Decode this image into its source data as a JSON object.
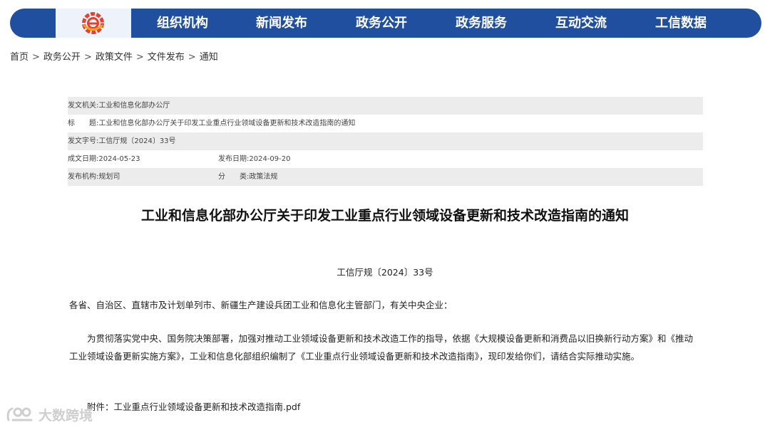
{
  "nav": {
    "logo_icon": "ministry-logo-icon",
    "items": [
      {
        "label": "组织机构"
      },
      {
        "label": "新闻发布"
      },
      {
        "label": "政务公开"
      },
      {
        "label": "政务服务"
      },
      {
        "label": "互动交流"
      },
      {
        "label": "工信数据"
      }
    ]
  },
  "breadcrumb": {
    "items": [
      "首页",
      "政务公开",
      "政策文件",
      "文件发布",
      "通知"
    ],
    "separator": ">"
  },
  "meta": {
    "issuer_label": "发文机关:",
    "issuer": "工业和信息化部办公厅",
    "title_label": "标　　题:",
    "title": "工业和信息化部办公厅关于印发工业重点行业领域设备更新和技术改造指南的通知",
    "doc_no_label": "发文字号:",
    "doc_no": "工信厅规〔2024〕33号",
    "created_label": "成文日期:",
    "created": "2024-05-23",
    "published_label": "发布日期:",
    "published": "2024-09-20",
    "org_label": "发布机构:",
    "org": "规划司",
    "category_label": "分　　类:",
    "category": "政策法规"
  },
  "document": {
    "title": "工业和信息化部办公厅关于印发工业重点行业领域设备更新和技术改造指南的通知",
    "number": "工信厅规〔2024〕33号",
    "addressee": "各省、自治区、直辖市及计划单列市、新疆生产建设兵团工业和信息化主管部门，有关中央企业：",
    "body": "为贯彻落实党中央、国务院决策部署，加强对推动工业领域设备更新和技术改造工作的指导，依据《大规模设备更新和消费品以旧换新行动方案》和《推动工业领域设备更新实施方案》，工业和信息化部组织编制了《工业重点行业领域设备更新和技术改造指南》，现印发给你们，请结合实际推动实施。",
    "attachment_label": "附件：",
    "attachment": "工业重点行业领域设备更新和技术改造指南.pdf"
  },
  "watermark": {
    "text": "大数跨境",
    "icon": "dashuju-logo-icon"
  },
  "colors": {
    "nav_bg": "#1f4f9e",
    "logo_bg": "#eef3fb",
    "meta_shade": "#ececec",
    "logo_red": "#e8402d",
    "logo_orange": "#f5a21b"
  }
}
